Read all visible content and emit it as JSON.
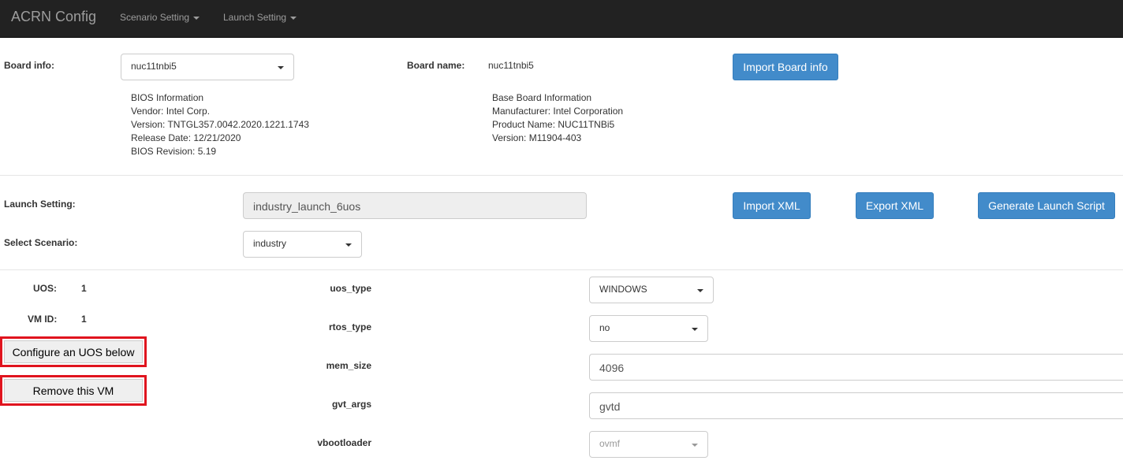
{
  "nav": {
    "brand": "ACRN Config",
    "scenario_setting": "Scenario Setting",
    "launch_setting": "Launch Setting"
  },
  "board": {
    "info_label": "Board info:",
    "info_value": "nuc11tnbi5",
    "name_label": "Board name:",
    "name_value": "nuc11tnbi5",
    "import_button": "Import Board info",
    "bios": [
      "BIOS Information",
      "Vendor: Intel Corp.",
      "Version: TNTGL357.0042.2020.1221.1743",
      "Release Date: 12/21/2020",
      "BIOS Revision: 5.19"
    ],
    "baseboard": [
      "Base Board Information",
      "Manufacturer: Intel Corporation",
      "Product Name: NUC11TNBi5",
      "Version: M11904-403"
    ]
  },
  "launch": {
    "setting_label": "Launch Setting:",
    "setting_value": "industry_launch_6uos",
    "scenario_label": "Select Scenario:",
    "scenario_value": "industry",
    "import_xml": "Import XML",
    "export_xml": "Export XML",
    "generate_script": "Generate Launch Script"
  },
  "vm": {
    "uos_label": "UOS:",
    "uos_value": "1",
    "vmid_label": "VM ID:",
    "vmid_value": "1",
    "configure_button": "Configure an UOS below",
    "remove_button": "Remove this VM",
    "fields": {
      "uos_type_label": "uos_type",
      "uos_type_value": "WINDOWS",
      "rtos_type_label": "rtos_type",
      "rtos_type_value": "no",
      "mem_size_label": "mem_size",
      "mem_size_value": "4096",
      "gvt_args_label": "gvt_args",
      "gvt_args_value": "gvtd",
      "vbootloader_label": "vbootloader",
      "vbootloader_value": "ovmf"
    }
  },
  "colors": {
    "navbar": "#222222",
    "primary_button": "#428bca",
    "highlight_border": "#e0141e"
  }
}
